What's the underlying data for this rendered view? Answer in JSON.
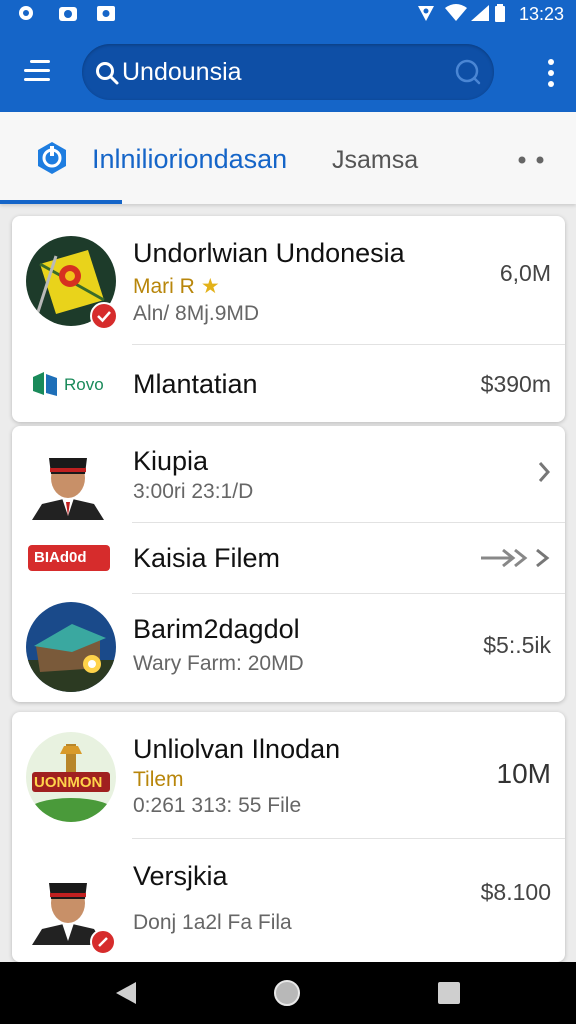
{
  "status_bar": {
    "time": "13:23",
    "icons": [
      "settings-icon",
      "camera-icon",
      "image-icon",
      "location-icon",
      "wifi-icon",
      "signal-icon",
      "battery-icon"
    ]
  },
  "app_bar": {
    "menu_icon": "hamburger-icon",
    "search": {
      "value": "Undounsia",
      "placeholder": ""
    },
    "overflow_icon": "more-vert-icon"
  },
  "tabs": {
    "active": {
      "label": "Inlnilioriondasan",
      "icon": "app-logo-icon"
    },
    "second": {
      "label": "Jsamsa"
    },
    "more_icon": "more-horiz-icon"
  },
  "cards": [
    {
      "items": [
        {
          "title": "Undorlwian Undonesia",
          "sub1": "Mari R",
          "sub2": "Aln/ 8Mj.9MD",
          "value": "6,0M",
          "icon": "flag-emblem-icon",
          "badge": "verified-badge-icon"
        },
        {
          "logo_text": "Rovo",
          "title": "Mlantatian",
          "value": "$390m"
        }
      ]
    },
    {
      "items": [
        {
          "title": "Kiupia",
          "sub2": "3:00ri 23:1/D",
          "icon": "person-portrait-icon"
        },
        {
          "logo_text": "BIAd0d",
          "title": "Kaisia Filem",
          "icon": "double-arrow-icon"
        },
        {
          "title": "Barim2dagdol",
          "sub2": "Wary Farm: 20MD",
          "value": "$5:.5ik",
          "icon": "house-scene-icon"
        }
      ]
    },
    {
      "items": [
        {
          "title": "Unliolvan Ilnodan",
          "sub1": "Tilem",
          "sub2": "0:261 313: 55 File",
          "value": "10M",
          "icon": "monument-logo-icon",
          "logo_text": "UONMON"
        },
        {
          "title": "Versjkia",
          "sub2": "Donj 1a2l Fa Fila",
          "value": "$8.100",
          "icon": "person-portrait-icon",
          "badge": "red-badge-icon"
        }
      ]
    }
  ],
  "nav_bar": {
    "back_icon": "back-icon",
    "home_icon": "home-icon",
    "recents_icon": "recents-icon"
  },
  "colors": {
    "primary": "#1565c8",
    "search_bg": "#0e4fa6",
    "gold": "#b8860b",
    "badge_red": "#d62c2c"
  }
}
